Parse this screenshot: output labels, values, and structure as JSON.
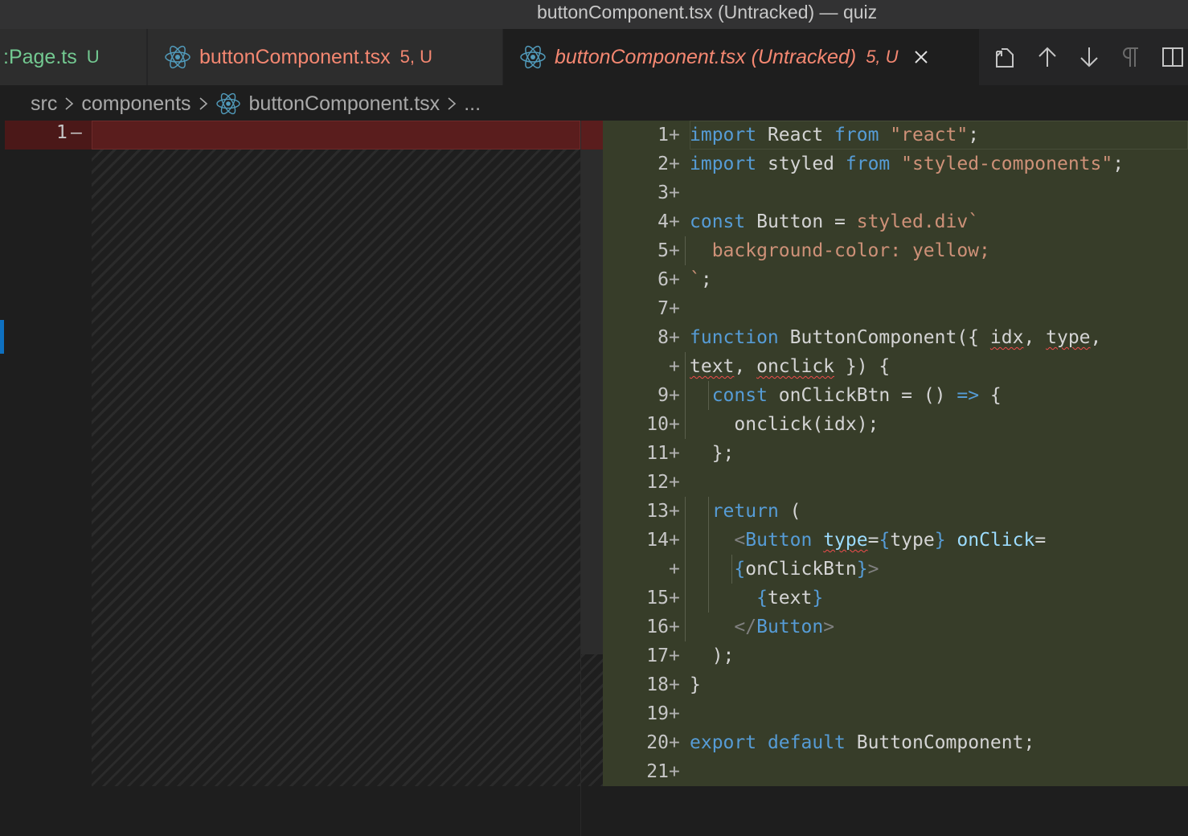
{
  "window": {
    "title": "buttonComponent.tsx (Untracked) — quiz"
  },
  "tabs": [
    {
      "label": ":Page.ts",
      "badge": "U"
    },
    {
      "label": "buttonComponent.tsx",
      "badge": "5, U"
    },
    {
      "label": "buttonComponent.tsx (Untracked)",
      "badge": "5, U"
    }
  ],
  "tab_actions": [
    "open-file-icon",
    "arrow-up-icon",
    "arrow-down-icon",
    "pilcrow-icon",
    "split-editor-icon"
  ],
  "breadcrumb": {
    "items": [
      "src",
      "components",
      "buttonComponent.tsx",
      "..."
    ]
  },
  "left_pane": {
    "line_number": "1",
    "marker": "—"
  },
  "right_pane": {
    "lines": [
      {
        "n": "1",
        "segments": [
          [
            "kw",
            "import"
          ],
          [
            "plain",
            " React "
          ],
          [
            "kw",
            "from"
          ],
          [
            "plain",
            " "
          ],
          [
            "str",
            "\"react\""
          ],
          [
            "plain",
            ";"
          ]
        ]
      },
      {
        "n": "2",
        "segments": [
          [
            "kw",
            "import"
          ],
          [
            "plain",
            " styled "
          ],
          [
            "kw",
            "from"
          ],
          [
            "plain",
            " "
          ],
          [
            "str",
            "\"styled-components\""
          ],
          [
            "plain",
            ";"
          ]
        ]
      },
      {
        "n": "3",
        "segments": []
      },
      {
        "n": "4",
        "segments": [
          [
            "kw",
            "const"
          ],
          [
            "plain",
            " Button = "
          ],
          [
            "str",
            "styled.div`"
          ]
        ]
      },
      {
        "n": "5",
        "segments": [
          [
            "str",
            "  background-color: yellow;"
          ]
        ]
      },
      {
        "n": "6",
        "segments": [
          [
            "str",
            "`"
          ],
          [
            "plain",
            ";"
          ]
        ]
      },
      {
        "n": "7",
        "segments": []
      },
      {
        "n": "8",
        "segments": [
          [
            "kw",
            "function"
          ],
          [
            "plain",
            " ButtonComponent({ "
          ],
          [
            "sq",
            "idx"
          ],
          [
            "plain",
            ", "
          ],
          [
            "sq",
            "type"
          ],
          [
            "plain",
            ","
          ]
        ]
      },
      {
        "n": "",
        "segments": [
          [
            "sq",
            "text"
          ],
          [
            "plain",
            ", "
          ],
          [
            "sq",
            "onclick"
          ],
          [
            "plain",
            " }) {"
          ]
        ]
      },
      {
        "n": "9",
        "segments": [
          [
            "plain",
            "  "
          ],
          [
            "kw",
            "const"
          ],
          [
            "plain",
            " onClickBtn = () "
          ],
          [
            "kw",
            "=>"
          ],
          [
            "plain",
            " {"
          ]
        ]
      },
      {
        "n": "10",
        "segments": [
          [
            "plain",
            "    onclick(idx);"
          ]
        ]
      },
      {
        "n": "11",
        "segments": [
          [
            "plain",
            "  };"
          ]
        ]
      },
      {
        "n": "12",
        "segments": []
      },
      {
        "n": "13",
        "segments": [
          [
            "plain",
            "  "
          ],
          [
            "kw",
            "return"
          ],
          [
            "plain",
            " ("
          ]
        ]
      },
      {
        "n": "14",
        "segments": [
          [
            "plain",
            "    "
          ],
          [
            "punc",
            "<"
          ],
          [
            "kw",
            "Button"
          ],
          [
            "plain",
            " "
          ],
          [
            "sqv",
            "type"
          ],
          [
            "plain",
            "="
          ],
          [
            "kw",
            "{"
          ],
          [
            "plain",
            "type"
          ],
          [
            "kw",
            "}"
          ],
          [
            "plain",
            " "
          ],
          [
            "var",
            "onClick"
          ],
          [
            "plain",
            "="
          ]
        ]
      },
      {
        "n": "",
        "segments": [
          [
            "plain",
            "    "
          ],
          [
            "kw",
            "{"
          ],
          [
            "plain",
            "onClickBtn"
          ],
          [
            "kw",
            "}"
          ],
          [
            "punc",
            ">"
          ]
        ]
      },
      {
        "n": "15",
        "segments": [
          [
            "plain",
            "      "
          ],
          [
            "kw",
            "{"
          ],
          [
            "plain",
            "text"
          ],
          [
            "kw",
            "}"
          ]
        ]
      },
      {
        "n": "16",
        "segments": [
          [
            "plain",
            "    "
          ],
          [
            "punc",
            "</"
          ],
          [
            "kw",
            "Button"
          ],
          [
            "punc",
            ">"
          ]
        ]
      },
      {
        "n": "17",
        "segments": [
          [
            "plain",
            "  );"
          ]
        ]
      },
      {
        "n": "18",
        "segments": [
          [
            "plain",
            "}"
          ]
        ]
      },
      {
        "n": "19",
        "segments": []
      },
      {
        "n": "20",
        "segments": [
          [
            "kw",
            "export"
          ],
          [
            "plain",
            " "
          ],
          [
            "kw",
            "default"
          ],
          [
            "plain",
            " ButtonComponent;"
          ]
        ]
      },
      {
        "n": "21",
        "segments": []
      }
    ]
  }
}
